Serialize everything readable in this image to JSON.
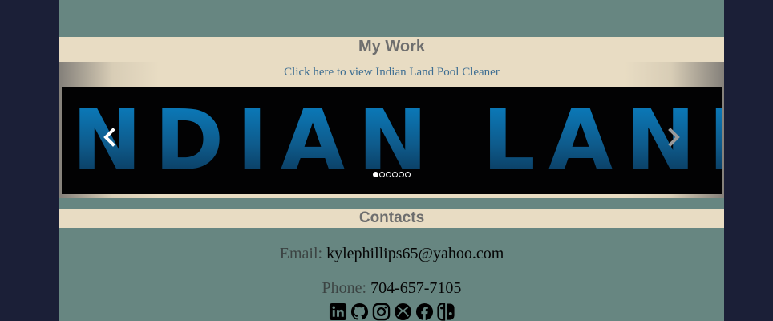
{
  "work": {
    "heading": "My Work",
    "link_text": "Click here to view Indian Land Pool Cleaner",
    "slide_text": "INDIAN LAND",
    "slide_count": 6,
    "active_slide": 1
  },
  "contacts": {
    "heading": "Contacts",
    "email_label": "Email:",
    "email_value": "kylephillips65@yahoo.com",
    "phone_label": "Phone:",
    "phone_value": "704-657-7105"
  },
  "socials": [
    "linkedin-icon",
    "github-icon",
    "instagram-icon",
    "xbox-icon",
    "facebook-icon",
    "nintendo-switch-icon"
  ],
  "colors": {
    "page_bg": "#1b1f37",
    "content_bg": "#678681",
    "band_bg": "#e8dcc3",
    "link": "#3f6f93",
    "slide_blue": "#0e5b8c"
  }
}
